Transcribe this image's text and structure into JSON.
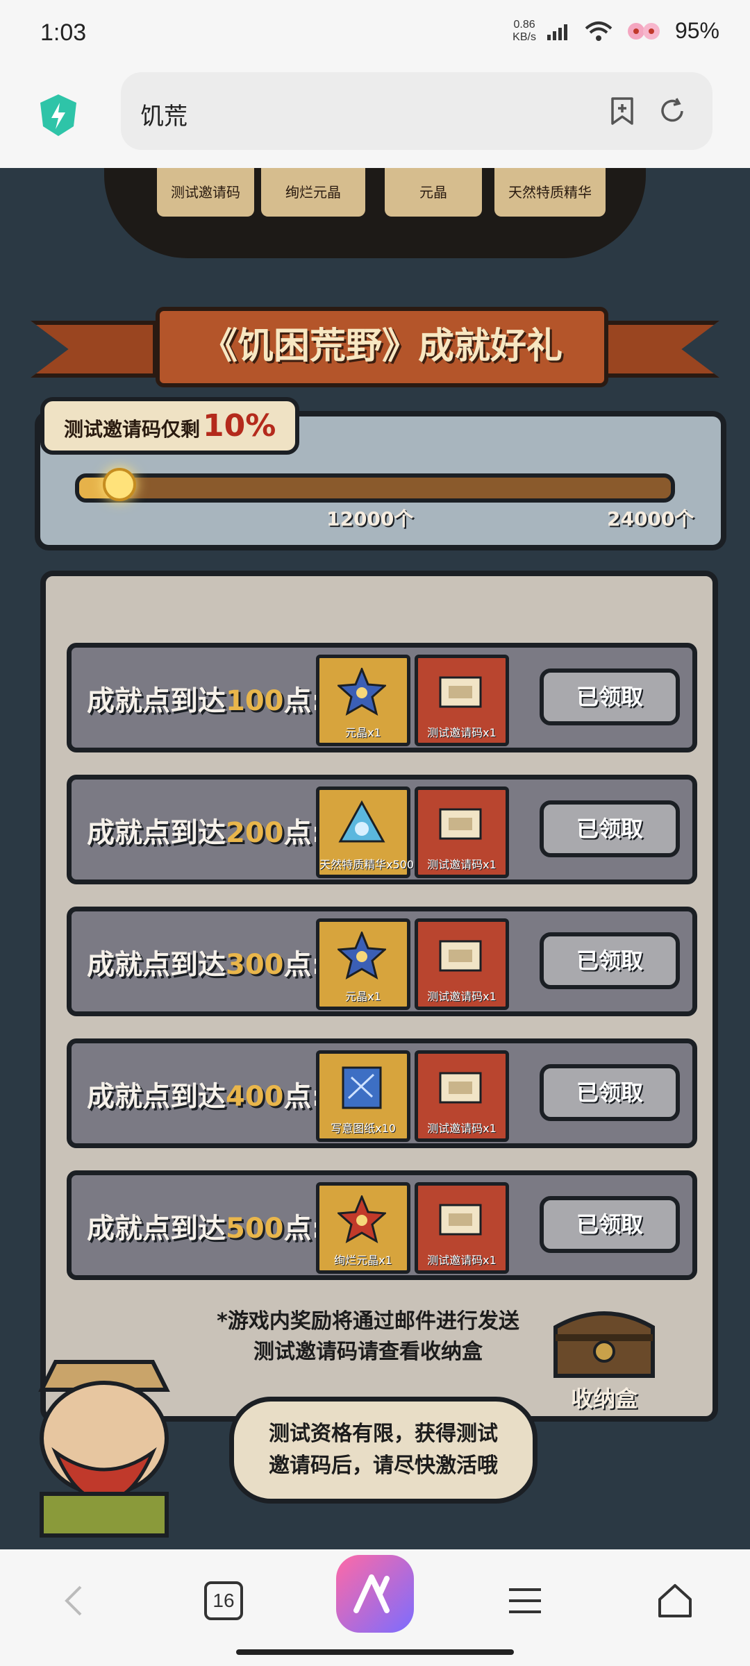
{
  "status": {
    "time": "1:03",
    "net_speed_value": "0.86",
    "net_speed_unit": "KB/s",
    "battery": "95%"
  },
  "browser": {
    "query": "饥荒"
  },
  "page": {
    "top_chips": [
      "测试邀请码",
      "绚烂元晶",
      "元晶",
      "天然特质精华"
    ],
    "banner_title": "《饥困荒野》成就好礼",
    "progress": {
      "tag_label": "测试邀请码仅剩",
      "tag_percent": "10%",
      "tick_mid": "12000个",
      "tick_end": "24000个",
      "fill_fraction": 0.07
    },
    "rows": [
      {
        "prefix": "成就点到达",
        "num": "100",
        "suffix": "点:",
        "reward1": "元晶x1",
        "reward1_style": "gold",
        "reward2": "测试邀请码x1",
        "claim": "已领取"
      },
      {
        "prefix": "成就点到达",
        "num": "200",
        "suffix": "点:",
        "reward1": "天然特质精华x500",
        "reward1_style": "gold",
        "reward2": "测试邀请码x1",
        "claim": "已领取"
      },
      {
        "prefix": "成就点到达",
        "num": "300",
        "suffix": "点:",
        "reward1": "元晶x1",
        "reward1_style": "gold",
        "reward2": "测试邀请码x1",
        "claim": "已领取"
      },
      {
        "prefix": "成就点到达",
        "num": "400",
        "suffix": "点:",
        "reward1": "写意图纸x10",
        "reward1_style": "blue",
        "reward2": "测试邀请码x1",
        "claim": "已领取"
      },
      {
        "prefix": "成就点到达",
        "num": "500",
        "suffix": "点:",
        "reward1": "绚烂元晶x1",
        "reward1_style": "gold",
        "reward2": "测试邀请码x1",
        "claim": "已领取"
      }
    ],
    "note_line1": "*游戏内奖励将通过邮件进行发送",
    "note_line2": "测试邀请码请查看收纳盒",
    "chest_label": "收纳盒",
    "bubble_line1": "测试资格有限，获得测试",
    "bubble_line2": "邀请码后，请尽快激活哦"
  },
  "nav": {
    "tabs_count": "16"
  },
  "colors": {
    "accent_gold": "#e9b64b",
    "panel_gray": "#7b7a84",
    "banner_red": "#b4552a"
  }
}
